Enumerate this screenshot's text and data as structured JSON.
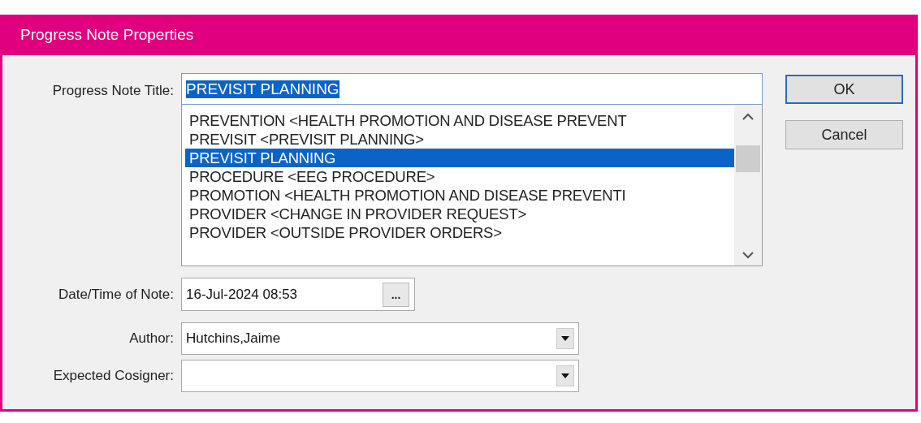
{
  "window": {
    "title": "Progress Note Properties"
  },
  "note_title": {
    "label": "Progress Note Title:",
    "value": "PREVISIT PLANNING",
    "text_selected": true,
    "options": [
      {
        "text": "PREVENTION  <HEALTH PROMOTION AND DISEASE PREVENT",
        "selected": false
      },
      {
        "text": "PREVISIT  <PREVISIT PLANNING>",
        "selected": false
      },
      {
        "text": "PREVISIT PLANNING",
        "selected": true
      },
      {
        "text": "PROCEDURE  <EEG PROCEDURE>",
        "selected": false
      },
      {
        "text": "PROMOTION  <HEALTH PROMOTION AND DISEASE PREVENTI",
        "selected": false
      },
      {
        "text": "PROVIDER  <CHANGE IN PROVIDER REQUEST>",
        "selected": false
      },
      {
        "text": "PROVIDER  <OUTSIDE PROVIDER ORDERS>",
        "selected": false
      }
    ]
  },
  "date_time": {
    "label": "Date/Time of Note:",
    "value": "16-Jul-2024 08:53",
    "button": "..."
  },
  "author": {
    "label": "Author:",
    "value": "Hutchins,Jaime"
  },
  "cosigner": {
    "label": "Expected Cosigner:"
  },
  "buttons": [
    {
      "label": "OK",
      "default": true
    },
    {
      "label": "Cancel",
      "default": false
    }
  ]
}
